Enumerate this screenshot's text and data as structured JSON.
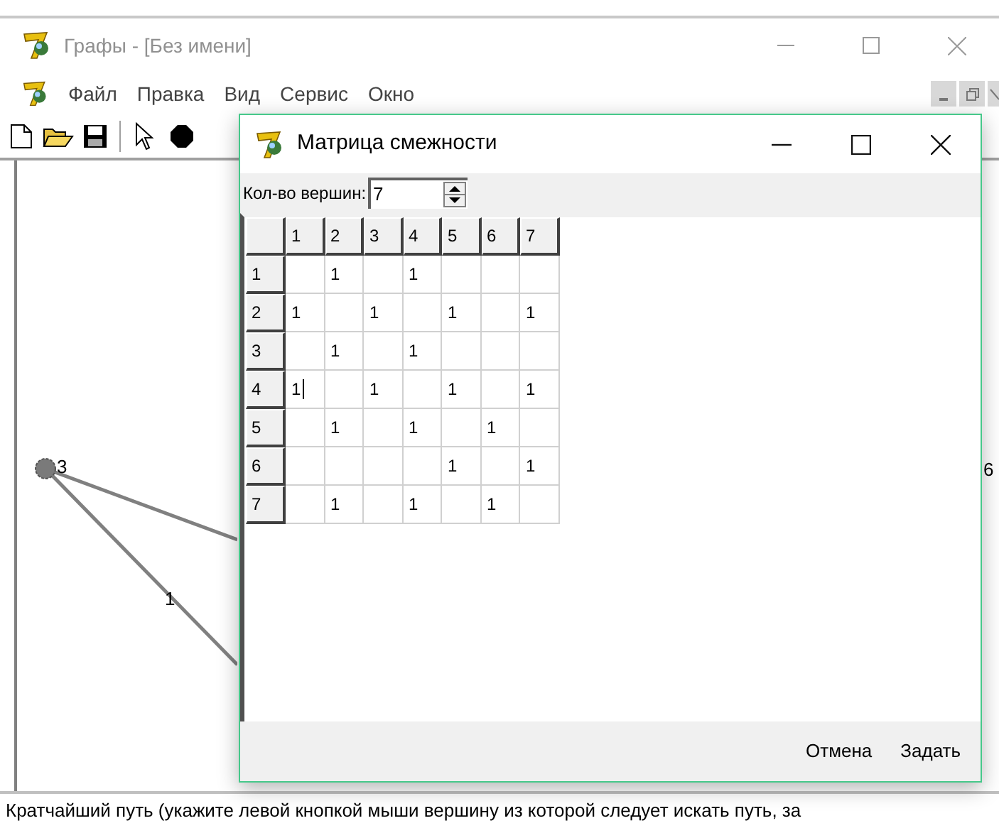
{
  "window": {
    "title": "Графы - [Без имени]"
  },
  "menu": [
    "Файл",
    "Правка",
    "Вид",
    "Сервис",
    "Окно"
  ],
  "canvas": {
    "nodes": [
      {
        "label": "3"
      },
      {
        "label": "6"
      }
    ],
    "edge_labels": [
      "1"
    ]
  },
  "dialog": {
    "title": "Матрица смежности",
    "vertex_count": {
      "label": "Кол-во вершин:",
      "value": "7"
    },
    "columns": [
      "1",
      "2",
      "3",
      "4",
      "5",
      "6",
      "7"
    ],
    "rows": [
      {
        "header": "1",
        "cells": [
          {
            "editing": false
          },
          {
            "value": "1",
            "editing": false
          },
          {
            "editing": false
          },
          {
            "value": "1",
            "editing": false
          },
          {
            "editing": false
          },
          {
            "editing": false
          },
          {
            "editing": false
          }
        ]
      },
      {
        "header": "2",
        "cells": [
          {
            "value": "1",
            "editing": false
          },
          {
            "editing": false
          },
          {
            "value": "1",
            "editing": false
          },
          {
            "editing": false
          },
          {
            "value": "1",
            "editing": false
          },
          {
            "editing": false
          },
          {
            "value": "1",
            "editing": false
          }
        ]
      },
      {
        "header": "3",
        "cells": [
          {
            "editing": false
          },
          {
            "value": "1",
            "editing": false
          },
          {
            "editing": false
          },
          {
            "value": "1",
            "editing": false
          },
          {
            "editing": false
          },
          {
            "editing": false
          },
          {
            "editing": false
          }
        ]
      },
      {
        "header": "4",
        "cells": [
          {
            "value": "1",
            "editing": true
          },
          {
            "editing": false
          },
          {
            "value": "1",
            "editing": false
          },
          {
            "editing": false
          },
          {
            "value": "1",
            "editing": false
          },
          {
            "editing": false
          },
          {
            "value": "1",
            "editing": false
          }
        ]
      },
      {
        "header": "5",
        "cells": [
          {
            "editing": false
          },
          {
            "value": "1",
            "editing": false
          },
          {
            "editing": false
          },
          {
            "value": "1",
            "editing": false
          },
          {
            "editing": false
          },
          {
            "value": "1",
            "editing": false
          },
          {
            "editing": false
          }
        ]
      },
      {
        "header": "6",
        "cells": [
          {
            "editing": false
          },
          {
            "editing": false
          },
          {
            "editing": false
          },
          {
            "editing": false
          },
          {
            "value": "1",
            "editing": false
          },
          {
            "editing": false
          },
          {
            "value": "1",
            "editing": false
          }
        ]
      },
      {
        "header": "7",
        "cells": [
          {
            "editing": false
          },
          {
            "value": "1",
            "editing": false
          },
          {
            "editing": false
          },
          {
            "value": "1",
            "editing": false
          },
          {
            "editing": false
          },
          {
            "value": "1",
            "editing": false
          },
          {
            "editing": false
          }
        ]
      }
    ],
    "buttons": [
      "Отмена",
      "Задать"
    ]
  },
  "status_bar": "Кратчайший путь (укажите левой кнопкой мыши вершину из которой следует искать путь, за"
}
